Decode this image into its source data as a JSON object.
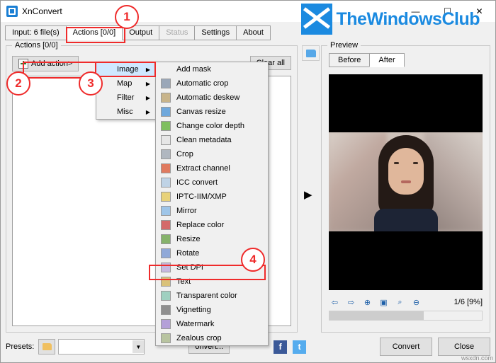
{
  "window": {
    "title": "XnConvert",
    "app_icon": "xnconvert-icon",
    "minimize": "—",
    "maximize": "☐",
    "close": "✕"
  },
  "watermark": {
    "text": "TheWindowsClub",
    "color": "#1b8ae0"
  },
  "tabs": [
    {
      "label": "Input: 6 file(s)",
      "active": false,
      "disabled": false
    },
    {
      "label": "Actions [0/0]",
      "active": true,
      "disabled": false
    },
    {
      "label": "Output",
      "active": false,
      "disabled": false
    },
    {
      "label": "Status",
      "active": false,
      "disabled": true
    },
    {
      "label": "Settings",
      "active": false,
      "disabled": false
    },
    {
      "label": "About",
      "active": false,
      "disabled": false
    }
  ],
  "actions_group": {
    "title": "Actions [0/0]",
    "add_action_label": "Add action>",
    "clear_all_label": "Clear all"
  },
  "menu_level1": [
    {
      "label": "Image",
      "has_submenu": true,
      "selected": true
    },
    {
      "label": "Map",
      "has_submenu": true,
      "selected": false
    },
    {
      "label": "Filter",
      "has_submenu": true,
      "selected": false
    },
    {
      "label": "Misc",
      "has_submenu": true,
      "selected": false
    }
  ],
  "menu_level2": [
    {
      "label": "Add mask",
      "icon": "",
      "color": ""
    },
    {
      "label": "Automatic crop",
      "icon": "crop-icon",
      "color": "#9aa7b8"
    },
    {
      "label": "Automatic deskew",
      "icon": "deskew-icon",
      "color": "#c8b48a"
    },
    {
      "label": "Canvas resize",
      "icon": "canvas-icon",
      "color": "#6fa8dc"
    },
    {
      "label": "Change color depth",
      "icon": "color-depth-icon",
      "color": "#7fbf5f"
    },
    {
      "label": "Clean metadata",
      "icon": "metadata-icon",
      "color": "#d8d8d8"
    },
    {
      "label": "Crop",
      "icon": "crop-icon",
      "color": "#b0b7c0"
    },
    {
      "label": "Extract channel",
      "icon": "channel-icon",
      "color": "#e07a5f"
    },
    {
      "label": "ICC convert",
      "icon": "icc-icon",
      "color": "#bfd3e6"
    },
    {
      "label": "IPTC-IIM/XMP",
      "icon": "iptc-icon",
      "color": "#e8d27a"
    },
    {
      "label": "Mirror",
      "icon": "mirror-icon",
      "color": "#9ec5e8"
    },
    {
      "label": "Replace color",
      "icon": "replace-color-icon",
      "color": "#d46a6a"
    },
    {
      "label": "Resize",
      "icon": "resize-icon",
      "color": "#86b36b"
    },
    {
      "label": "Rotate",
      "icon": "rotate-icon",
      "color": "#8fa8d8"
    },
    {
      "label": "Set DPI",
      "icon": "set-dpi-icon",
      "color": "#c7b8e0"
    },
    {
      "label": "Text",
      "icon": "text-icon",
      "color": "#d9c27a"
    },
    {
      "label": "Transparent color",
      "icon": "transparent-color-icon",
      "color": "#9fd0c0"
    },
    {
      "label": "Vignetting",
      "icon": "vignetting-icon",
      "color": "#8f8f8f"
    },
    {
      "label": "Watermark",
      "icon": "watermark-icon",
      "color": "#b4a0d8"
    },
    {
      "label": "Zealous crop",
      "icon": "zealous-crop-icon",
      "color": "#b8c4a0"
    }
  ],
  "preview": {
    "group_title": "Preview",
    "tabs": [
      {
        "label": "Before",
        "active": false
      },
      {
        "label": "After",
        "active": true
      }
    ],
    "zoom_label": "1/6 [9%]",
    "controls": [
      {
        "name": "prev-image-icon",
        "glyph": "⇦"
      },
      {
        "name": "next-image-icon",
        "glyph": "⇨"
      },
      {
        "name": "zoom-in-icon",
        "glyph": "⊕"
      },
      {
        "name": "fit-to-window-icon",
        "glyph": "▣"
      },
      {
        "name": "zoom-actual-icon",
        "glyph": "⌕"
      },
      {
        "name": "zoom-out-icon",
        "glyph": "⊖"
      }
    ]
  },
  "bottom": {
    "presets_label": "Presets:",
    "preset_value": "",
    "convert_ghost_label": "onvert...",
    "convert_label": "Convert",
    "close_label": "Close",
    "facebook": "f",
    "twitter": "t"
  },
  "annotations": {
    "step1": "1",
    "step2": "2",
    "step3": "3",
    "step4": "4",
    "color": "#ef2b2b"
  },
  "footer_watermark": "wsxdn.com"
}
